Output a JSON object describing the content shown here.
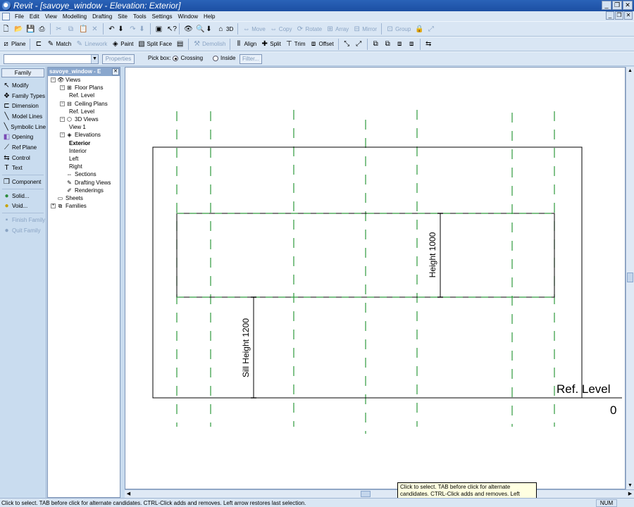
{
  "window": {
    "title": "Revit - [savoye_window - Elevation: Exterior]"
  },
  "menu": [
    "File",
    "Edit",
    "View",
    "Modelling",
    "Drafting",
    "Site",
    "Tools",
    "Settings",
    "Window",
    "Help"
  ],
  "toolbar1": {
    "view_3d": "3D",
    "move": "Move",
    "copy": "Copy",
    "rotate": "Rotate",
    "array": "Array",
    "mirror": "Mirror",
    "group": "Group"
  },
  "toolbar2": {
    "plane": "Plane",
    "match": "Match",
    "linework": "Linework",
    "paint": "Paint",
    "split_face": "Split Face",
    "demolish": "Demolish",
    "align": "Align",
    "split": "Split",
    "trim": "Trim",
    "offset": "Offset"
  },
  "options_bar": {
    "type_selector_value": "",
    "properties_label": "Properties",
    "pick_box_label": "Pick box:",
    "crossing_label": "Crossing",
    "inside_label": "Inside",
    "selected_mode": "Crossing",
    "filter_label": "Filter..."
  },
  "design_bar": {
    "tab": "Family",
    "items": [
      {
        "label": "Modify",
        "icon": "arrow-cursor-icon"
      },
      {
        "label": "Family Types",
        "icon": "family-types-icon"
      },
      {
        "label": "Dimension",
        "icon": "dimension-icon"
      },
      {
        "label": "Model Lines",
        "icon": "model-lines-icon"
      },
      {
        "label": "Symbolic Line",
        "icon": "symbolic-line-icon"
      },
      {
        "label": "Opening",
        "icon": "opening-icon"
      },
      {
        "label": "Ref Plane",
        "icon": "ref-plane-icon"
      },
      {
        "label": "Control",
        "icon": "control-icon"
      },
      {
        "label": "Text",
        "icon": "text-icon"
      }
    ],
    "items2": [
      {
        "label": "Component",
        "icon": "component-icon"
      }
    ],
    "items3": [
      {
        "label": "Solid...",
        "icon": "solid-icon"
      },
      {
        "label": "Void...",
        "icon": "void-icon"
      }
    ],
    "items4": [
      {
        "label": "Finish Family",
        "icon": "finish-family-icon"
      },
      {
        "label": "Quit Family",
        "icon": "quit-family-icon"
      }
    ]
  },
  "browser": {
    "header": "savoye_window - E",
    "nodes": [
      {
        "label": "Views",
        "indent": 0,
        "toggle": "−",
        "icon": "eye-icon"
      },
      {
        "label": "Floor Plans",
        "indent": 1,
        "toggle": "−",
        "icon": "floor-plan-icon"
      },
      {
        "label": "Ref. Level",
        "indent": 2,
        "toggle": "",
        "icon": ""
      },
      {
        "label": "Ceiling Plans",
        "indent": 1,
        "toggle": "−",
        "icon": "ceiling-plan-icon"
      },
      {
        "label": "Ref. Level",
        "indent": 2,
        "toggle": "",
        "icon": ""
      },
      {
        "label": "3D Views",
        "indent": 1,
        "toggle": "−",
        "icon": "cube-icon"
      },
      {
        "label": "View 1",
        "indent": 2,
        "toggle": "",
        "icon": ""
      },
      {
        "label": "Elevations",
        "indent": 1,
        "toggle": "−",
        "icon": "elevation-icon"
      },
      {
        "label": "Exterior",
        "indent": 2,
        "toggle": "",
        "icon": "",
        "bold": true
      },
      {
        "label": "Interior",
        "indent": 2,
        "toggle": "",
        "icon": ""
      },
      {
        "label": "Left",
        "indent": 2,
        "toggle": "",
        "icon": ""
      },
      {
        "label": "Right",
        "indent": 2,
        "toggle": "",
        "icon": ""
      },
      {
        "label": "Sections",
        "indent": 1,
        "toggle": "",
        "icon": "section-icon"
      },
      {
        "label": "Drafting Views",
        "indent": 1,
        "toggle": "",
        "icon": "drafting-icon"
      },
      {
        "label": "Renderings",
        "indent": 1,
        "toggle": "",
        "icon": "rendering-icon"
      },
      {
        "label": "Sheets",
        "indent": 0,
        "toggle": "",
        "icon": "sheet-icon"
      },
      {
        "label": "Families",
        "indent": 0,
        "toggle": "+",
        "icon": "families-icon"
      }
    ]
  },
  "drawing": {
    "dim_height": "Height 1000",
    "dim_sill": "Sill Height 1200",
    "level_name": "Ref. Level",
    "level_value": "0",
    "line_color": "#000000",
    "ref_plane_color": "#2e9a3c"
  },
  "status": {
    "text": "Click to select. TAB before click for alternate candidates. CTRL-Click adds and removes. Left arrow restores last selection.",
    "num": "NUM"
  },
  "tooltip": {
    "text": "Click to select. TAB before click for alternate candidates. CTRL-Click adds and removes. Left arrow restores last selection."
  }
}
